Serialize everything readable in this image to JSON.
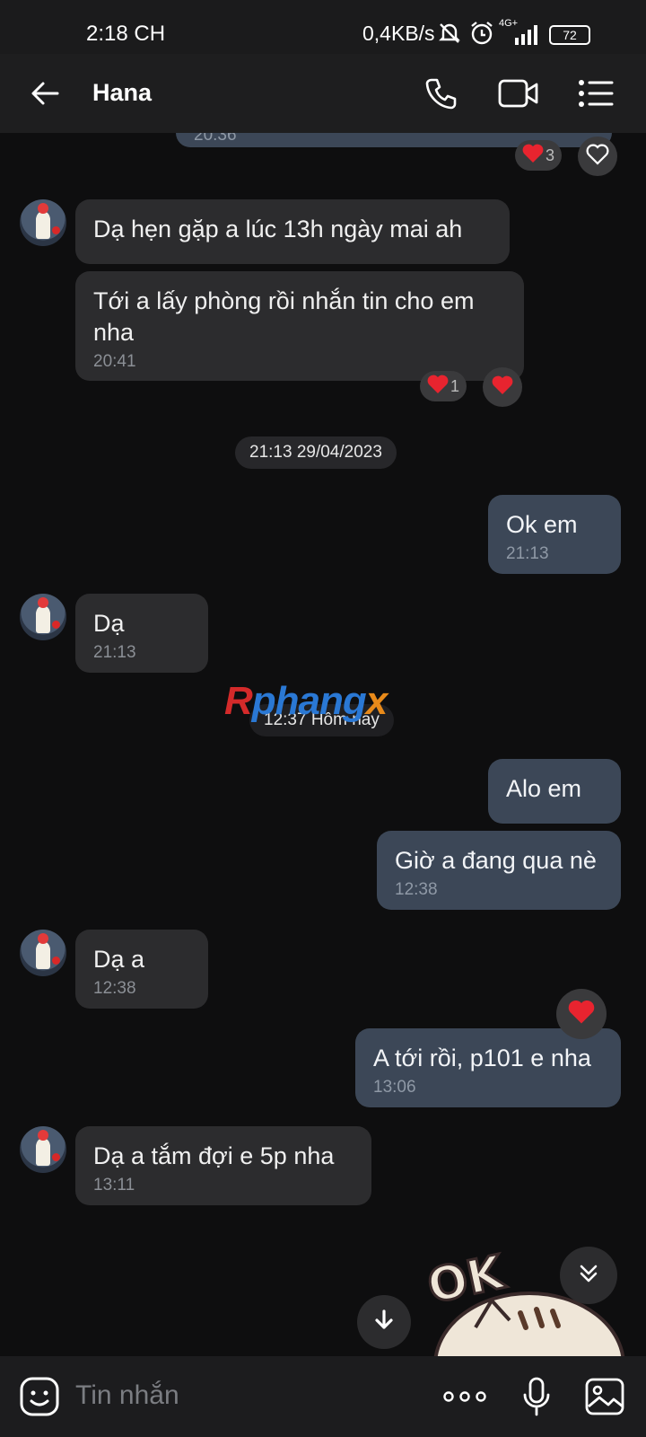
{
  "status": {
    "time": "2:18 CH",
    "net_speed": "0,4KB/s",
    "network": "4G+",
    "battery": "72"
  },
  "header": {
    "contact_name": "Hana"
  },
  "watermark": {
    "part1": "R",
    "part2": "phang",
    "part3": "x"
  },
  "messages": {
    "top_partial_time": "20:36",
    "top_reaction_count": "3",
    "m1": {
      "text": "Dạ hẹn gặp a lúc 13h ngày mai ah"
    },
    "m2": {
      "text_line1": "Tới a lấy phòng rồi nhắn tin cho em",
      "text_line2": "nha",
      "time": "20:41",
      "reaction_count": "1"
    },
    "date1": "21:13 29/04/2023",
    "m3": {
      "text": "Ok em",
      "time": "21:13"
    },
    "m4": {
      "text": "Dạ",
      "time": "21:13"
    },
    "date2": "12:37 Hôm nay",
    "m5": {
      "text": "Alo em"
    },
    "m6": {
      "text": "Giờ a đang qua nè",
      "time": "12:38"
    },
    "m7": {
      "text": "Dạ a",
      "time": "12:38"
    },
    "m8": {
      "text": "A tới rồi, p101 e nha",
      "time": "13:06"
    },
    "m9": {
      "text": "Dạ a tắm đợi e 5p nha",
      "time": "13:11"
    },
    "sticker_text": "OK"
  },
  "input": {
    "placeholder": "Tin nhắn"
  },
  "colors": {
    "bubble_in": "#2c2c2e",
    "bubble_out": "#3c4757",
    "heart": "#e8242f",
    "background": "#0e0e0f"
  }
}
